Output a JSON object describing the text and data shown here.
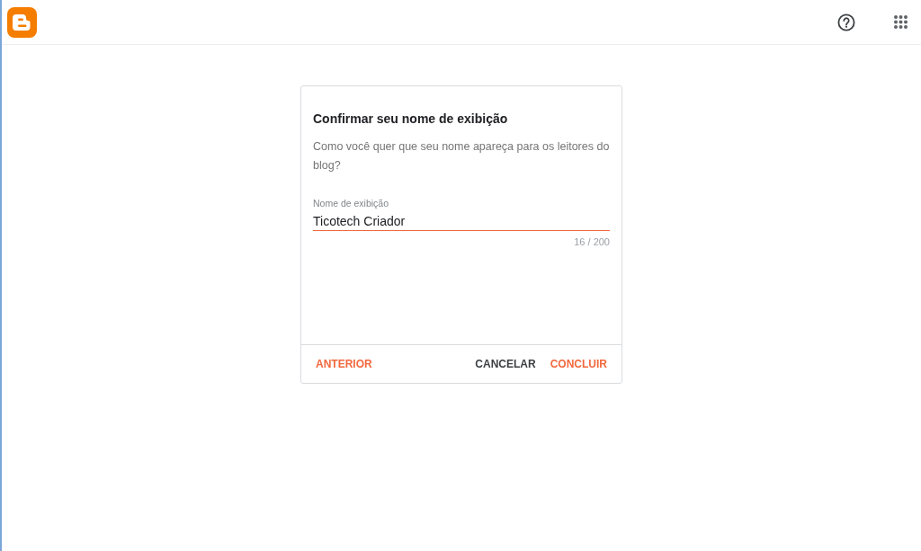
{
  "dialog": {
    "title": "Confirmar seu nome de exibição",
    "description": "Como você quer que seu nome apareça para os leitores do blog?",
    "field": {
      "label": "Nome de exibição",
      "value": "Ticotech Criador",
      "focused": true,
      "counter": "16 / 200"
    },
    "footer": {
      "left_buttons": [
        {
          "label": "ANTERIOR",
          "kind": "accent"
        }
      ],
      "right_buttons": [
        {
          "label": "CANCELAR",
          "kind": "plain"
        },
        {
          "label": "CONCLUIR",
          "kind": "accent"
        }
      ]
    }
  }
}
